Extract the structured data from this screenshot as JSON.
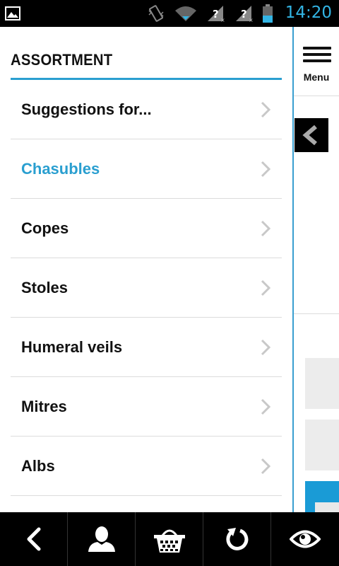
{
  "status_bar": {
    "time": "14:20",
    "icons": [
      "gallery-icon",
      "vibrate-icon",
      "wifi-icon",
      "no-sim-icon",
      "no-sim-icon",
      "battery-icon"
    ]
  },
  "drawer": {
    "title": "ASSORTMENT",
    "items": [
      {
        "label": "Suggestions for...",
        "active": false
      },
      {
        "label": "Chasubles",
        "active": true
      },
      {
        "label": "Copes",
        "active": false
      },
      {
        "label": "Stoles",
        "active": false
      },
      {
        "label": "Humeral veils",
        "active": false
      },
      {
        "label": "Mitres",
        "active": false
      },
      {
        "label": "Albs",
        "active": false
      }
    ]
  },
  "side_panel": {
    "menu_label": "Menu"
  },
  "bottom_nav": {
    "buttons": [
      "back-icon",
      "account-icon",
      "basket-icon",
      "refresh-icon",
      "eye-icon"
    ]
  },
  "colors": {
    "accent": "#2a9fd0",
    "status_time": "#33b5e5",
    "text": "#111111",
    "separator": "#dcdcdc"
  }
}
